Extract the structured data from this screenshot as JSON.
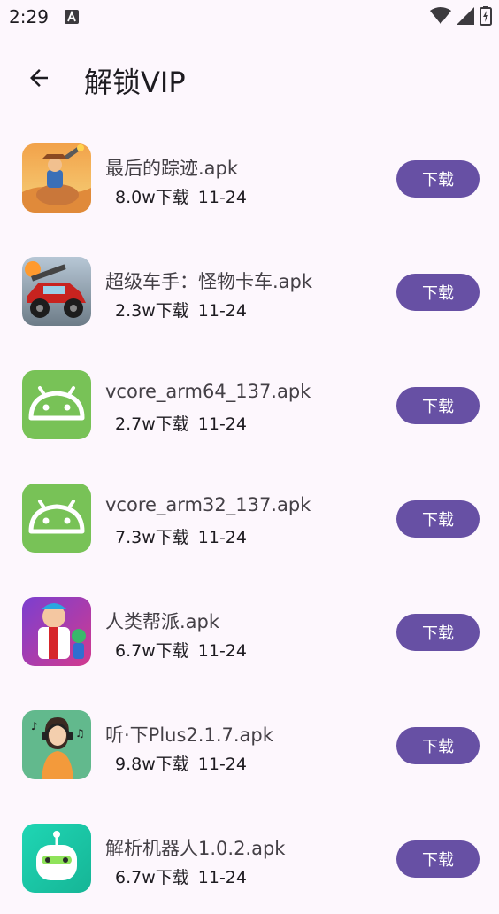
{
  "status_bar": {
    "time": "2:29",
    "icons": [
      "notification-a-icon",
      "wifi-icon",
      "signal-icon",
      "battery-charging-icon"
    ]
  },
  "header": {
    "back_icon": "arrow-back-icon",
    "title": "解锁VIP"
  },
  "colors": {
    "background": "#fdf7fd",
    "accent": "#6750a4",
    "button_text": "#ffffff",
    "android_green": "#78c257"
  },
  "apps": [
    {
      "name": "最后的踪迹.apk",
      "downloads": "8.0w下载",
      "date": "11-24",
      "button": "下载",
      "icon": "cowboy-game-icon"
    },
    {
      "name": "超级车手：怪物卡车.apk",
      "downloads": "2.3w下载",
      "date": "11-24",
      "button": "下载",
      "icon": "monster-truck-game-icon"
    },
    {
      "name": "vcore_arm64_137.apk",
      "downloads": "2.7w下载",
      "date": "11-24",
      "button": "下载",
      "icon": "android-icon"
    },
    {
      "name": "vcore_arm32_137.apk",
      "downloads": "7.3w下载",
      "date": "11-24",
      "button": "下载",
      "icon": "android-icon"
    },
    {
      "name": "人类帮派.apk",
      "downloads": "6.7w下载",
      "date": "11-24",
      "button": "下载",
      "icon": "gang-game-icon"
    },
    {
      "name": "听·下Plus2.1.7.apk",
      "downloads": "9.8w下载",
      "date": "11-24",
      "button": "下载",
      "icon": "music-girl-icon"
    },
    {
      "name": "解析机器人1.0.2.apk",
      "downloads": "6.7w下载",
      "date": "11-24",
      "button": "下载",
      "icon": "robot-icon"
    }
  ]
}
